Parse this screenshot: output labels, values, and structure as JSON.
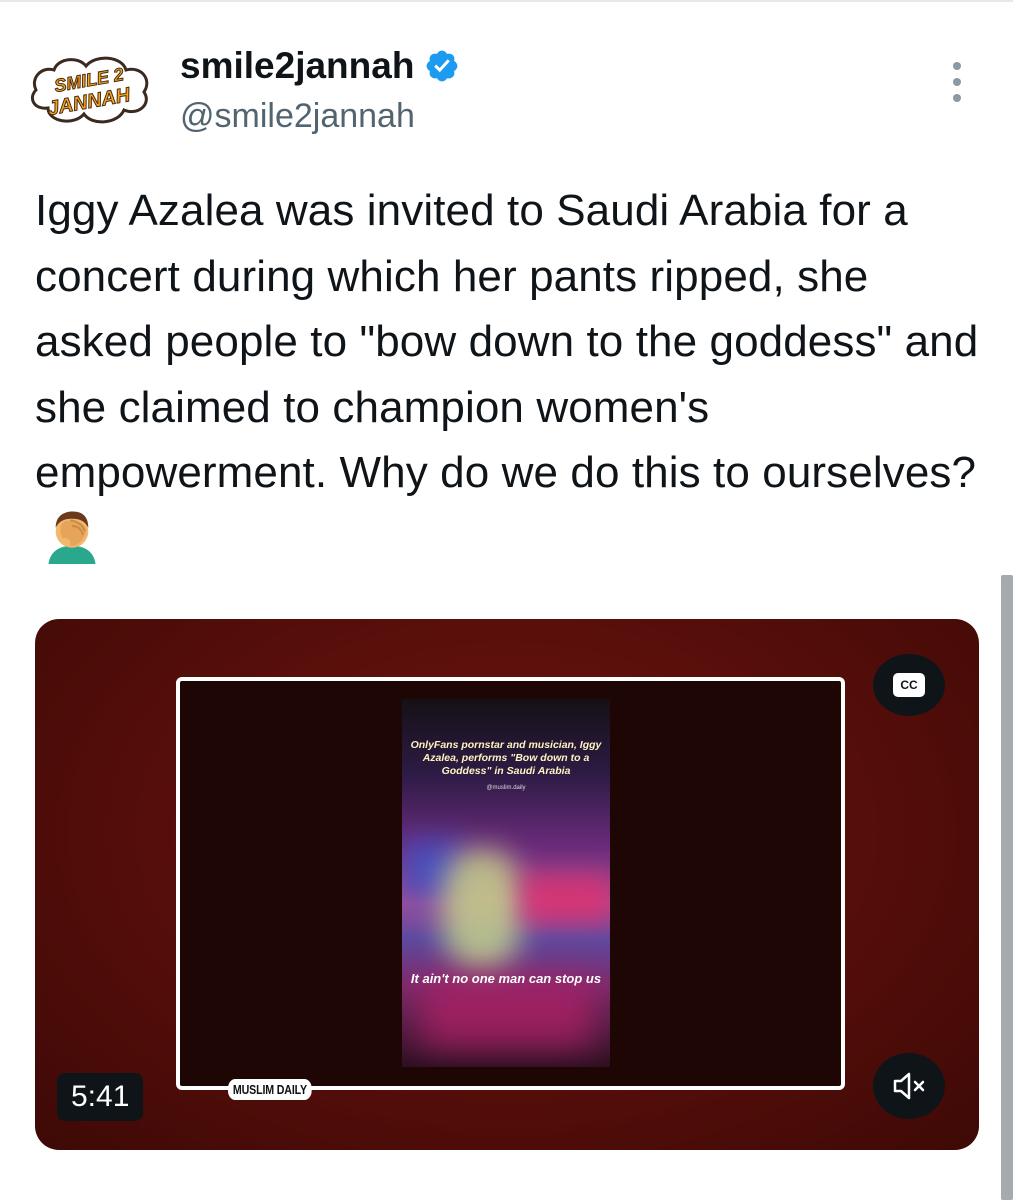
{
  "author": {
    "display_name": "smile2jannah",
    "handle": "@smile2jannah",
    "avatar_text": "SMILE 2 JANNAH",
    "verified_icon": "verified-badge-icon"
  },
  "tweet": {
    "text": "Iggy Azalea was invited to Saudi Arabia for a concert during which her pants ripped, she asked people to \"bow down to the goddess\" and she claimed to champion women's empowerment. Why do we do this to ourselves?",
    "emoji": "facepalm-emoji"
  },
  "media": {
    "duration": "5:41",
    "cc_label": "CC",
    "clip_caption": "OnlyFans pornstar and musician, Iggy Azalea, performs \"Bow down to a Goddess\" in Saudi Arabia",
    "clip_watermark": "@muslim.daily",
    "clip_lyric": "It ain't no one man can stop us",
    "brand_badge": "MUSLIM DAILY",
    "mute_icon": "volume-muted-icon",
    "cc_icon": "closed-captions-icon"
  },
  "colors": {
    "accent": "#1d9bf0",
    "text": "#0f1419",
    "secondary": "#536471",
    "media_bg": "#5a0f0b"
  }
}
